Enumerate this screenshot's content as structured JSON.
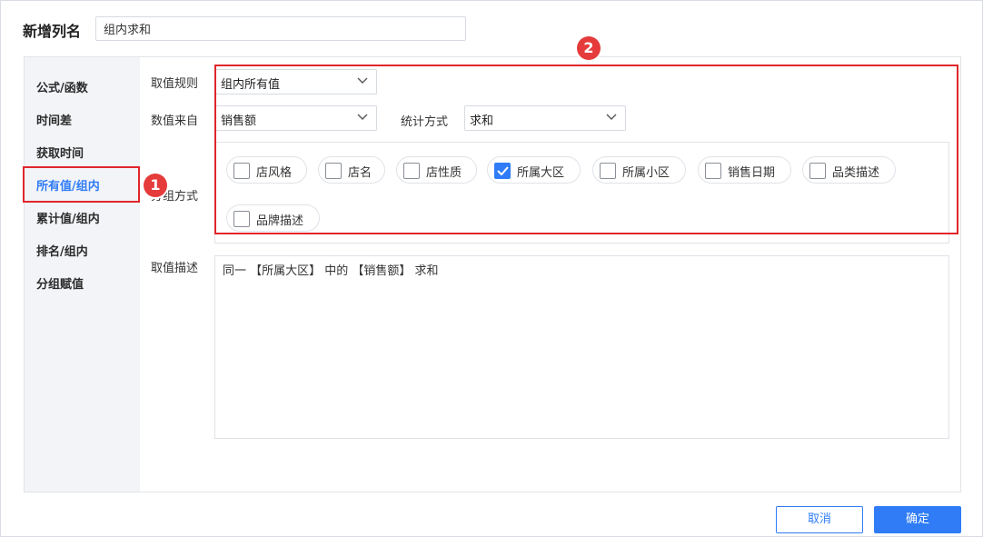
{
  "header": {
    "title": "新增列名",
    "column_name_value": "组内求和"
  },
  "sidebar": {
    "items": [
      {
        "label": "公式/函数",
        "active": false
      },
      {
        "label": "时间差",
        "active": false
      },
      {
        "label": "获取时间",
        "active": false
      },
      {
        "label": "所有值/组内",
        "active": true
      },
      {
        "label": "累计值/组内",
        "active": false
      },
      {
        "label": "排名/组内",
        "active": false
      },
      {
        "label": "分组赋值",
        "active": false
      }
    ]
  },
  "form": {
    "value_rule_label": "取值规则",
    "value_rule_selected": "组内所有值",
    "value_source_label": "数值来自",
    "value_source_selected": "销售额",
    "stat_method_label": "统计方式",
    "stat_method_selected": "求和",
    "group_method_label": "分组方式",
    "group_options": [
      {
        "label": "店风格",
        "checked": false
      },
      {
        "label": "店名",
        "checked": false
      },
      {
        "label": "店性质",
        "checked": false
      },
      {
        "label": "所属大区",
        "checked": true
      },
      {
        "label": "所属小区",
        "checked": false
      },
      {
        "label": "销售日期",
        "checked": false
      },
      {
        "label": "品类描述",
        "checked": false
      },
      {
        "label": "品牌描述",
        "checked": false
      }
    ],
    "description_label": "取值描述",
    "description_text": "同一 【所属大区】 中的 【销售额】 求和"
  },
  "footer": {
    "cancel_label": "取消",
    "confirm_label": "确定"
  },
  "annotations": {
    "marker_1": "1",
    "marker_2": "2",
    "color": "#e1262c"
  },
  "colors": {
    "accent": "#2f7cf6",
    "sidebar_bg": "#f2f4f7"
  },
  "icons": {
    "dropdown": "chevron-down-icon",
    "check": "check-icon"
  }
}
